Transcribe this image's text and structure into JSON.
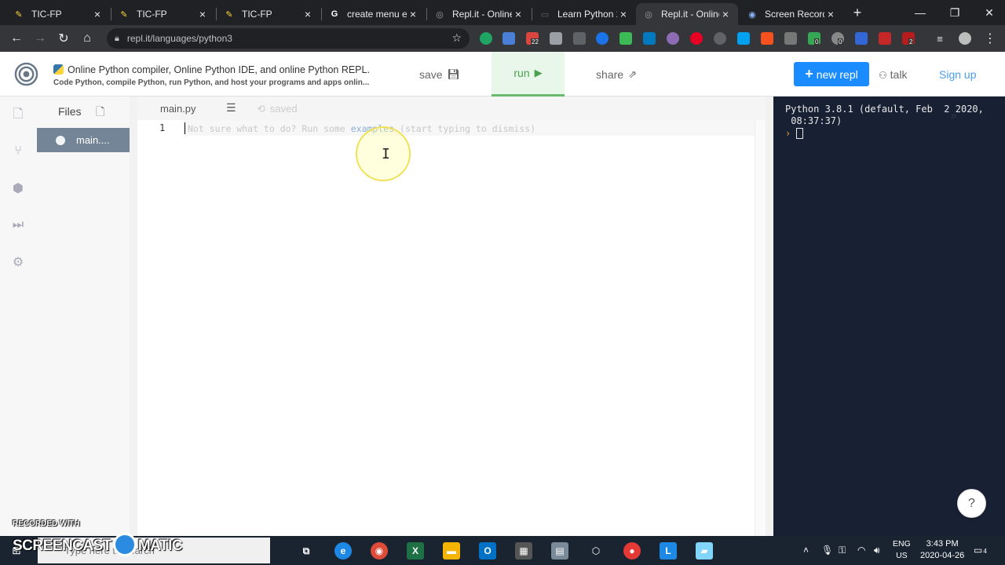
{
  "browser": {
    "tabs": [
      {
        "title": "TIC-FP",
        "favicon": "python-icon",
        "active": false
      },
      {
        "title": "TIC-FP",
        "favicon": "python-icon",
        "active": false
      },
      {
        "title": "TIC-FP",
        "favicon": "python-icon",
        "active": false
      },
      {
        "title": "create menu e",
        "favicon": "google-icon",
        "active": false
      },
      {
        "title": "Repl.it - Online",
        "favicon": "replit-icon",
        "active": false
      },
      {
        "title": "Learn Python 2",
        "favicon": "page-icon",
        "active": false
      },
      {
        "title": "Repl.it - Online",
        "favicon": "replit-icon",
        "active": true
      },
      {
        "title": "Screen Record",
        "favicon": "record-icon",
        "active": false
      }
    ],
    "new_tab": "+",
    "url": "repl.it/languages/python3",
    "extension_badges": {
      "ext1": "22",
      "ext2": "0",
      "ext3": "0",
      "ext4": "2"
    }
  },
  "header": {
    "title": "Online Python compiler, Online Python IDE, and online Python REPL.",
    "subtitle": "Code Python, compile Python, run Python, and host your programs and apps onlin...",
    "save_label": "save",
    "run_label": "run",
    "share_label": "share",
    "new_repl_label": "new repl",
    "new_repl_plus": "+",
    "talk_label": "talk",
    "signup_label": "Sign up"
  },
  "sidebar": {
    "files_title": "Files",
    "files": [
      {
        "name": "main...."
      }
    ]
  },
  "editor": {
    "tab_name": "main.py",
    "status": "saved",
    "line_number": "1",
    "placeholder_before": "Not sure what to do? Run some ",
    "placeholder_link": "examples",
    "placeholder_after": " (start typing to dismiss)"
  },
  "console": {
    "banner": "Python 3.8.1 (default, Feb  2 2020, \n 08:37:37)",
    "prompt": "›"
  },
  "help": {
    "label": "?"
  },
  "taskbar": {
    "search_placeholder": "Type here to search",
    "lang_top": "ENG",
    "lang_bottom": "US",
    "time": "3:43 PM",
    "date": "2020-04-26",
    "notification_count": "4"
  },
  "watermark": {
    "line1": "RECORDED WITH",
    "brand_left": "SCREENCAST",
    "brand_right": "MATIC"
  },
  "colors": {
    "accent": "#1a8cff",
    "run_green": "#4aa24f",
    "console_bg": "#182033",
    "file_selected": "#748598"
  }
}
